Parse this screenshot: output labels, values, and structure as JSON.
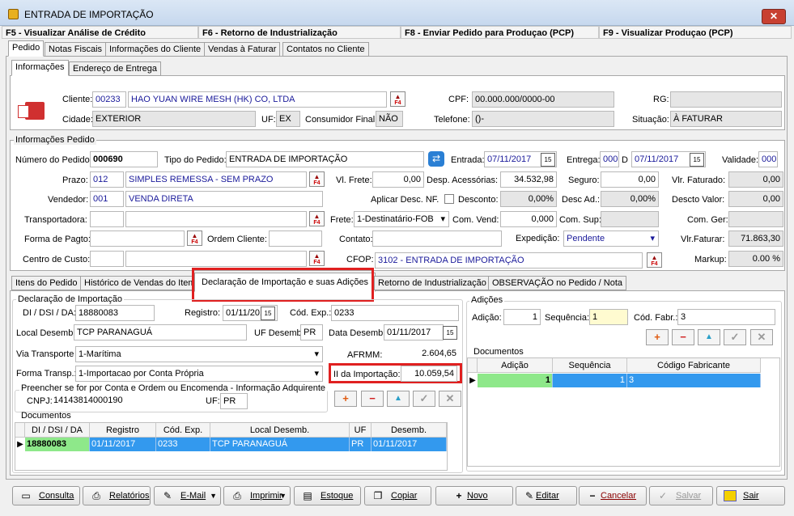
{
  "window": {
    "title": "ENTRADA DE IMPORTAÇÃO",
    "close": "✕"
  },
  "fkeys": [
    "F5 - Visualizar Análise de Crédito",
    "F6 - Retorno de Industrialização",
    "F8 - Enviar Pedido para Produçao (PCP)",
    "F9 - Visualizar Produçao (PCP)"
  ],
  "main_tabs": [
    "Pedido",
    "Notas Fiscais",
    "Informações do Cliente",
    "Vendas à Faturar",
    "Contatos no Cliente"
  ],
  "sub_tabs": [
    "Informações",
    "Endereço de Entrega"
  ],
  "client": {
    "cliente_label": "Cliente:",
    "cliente_code": "00233",
    "cliente_name": "HAO YUAN WIRE MESH (HK) CO, LTDA",
    "cpf_label": "CPF:",
    "cpf": "00.000.000/0000-00",
    "rg_label": "RG:",
    "cidade_label": "Cidade:",
    "cidade": "EXTERIOR",
    "uf_label": "UF:",
    "uf": "EX",
    "consumidor_label": "Consumidor Final:",
    "consumidor": "NÃO",
    "telefone_label": "Telefone:",
    "telefone": "()-",
    "situacao_label": "Situação:",
    "situacao": "À FATURAR"
  },
  "pedido": {
    "group_title": "Informações Pedido",
    "numero_label": "Número do Pedido:",
    "numero": "000690",
    "tipo_label": "Tipo do Pedido:",
    "tipo": "ENTRADA DE IMPORTAÇÃO",
    "entrada_label": "Entrada:",
    "entrada": "07/11/2017",
    "entrega_label": "Entrega:",
    "entrega_dias": "000",
    "entrega_d": "D",
    "entrega_date": "07/11/2017",
    "validade_label": "Validade:",
    "validade": "000",
    "prazo_label": "Prazo:",
    "prazo_code": "012",
    "prazo_name": "SIMPLES REMESSA - SEM PRAZO",
    "frete_label": "Vl. Frete:",
    "frete": "0,00",
    "desp_label": "Desp. Acessórias:",
    "desp": "34.532,98",
    "seguro_label": "Seguro:",
    "seguro": "0,00",
    "vlrfat_label": "Vlr. Faturado:",
    "vlrfat": "0,00",
    "vendedor_label": "Vendedor:",
    "vendedor_code": "001",
    "vendedor_name": "VENDA DIRETA",
    "aplicar_label": "Aplicar Desc. NF.",
    "desconto_label": "Desconto:",
    "desconto": "0,00%",
    "descad_label": "Desc Ad.:",
    "descad": "0,00%",
    "descval_label": "Descto Valor:",
    "descval": "0,00",
    "transp_label": "Transportadora:",
    "fretetype_label": "Frete:",
    "fretetype": "1-Destinatário-FOB",
    "comvend_label": "Com. Vend:",
    "comvend": "0,000",
    "comsup_label": "Com. Sup:",
    "comger_label": "Com. Ger:",
    "formapag_label": "Forma de Pagto:",
    "ordem_label": "Ordem Cliente:",
    "contato_label": "Contato:",
    "expedicao_label": "Expedição:",
    "expedicao": "Pendente",
    "vlrfatur_label": "Vlr.Faturar:",
    "vlrfatur": "71.863,30",
    "custo_label": "Centro de Custo:",
    "cfop_label": "CFOP:",
    "cfop": "3102 - ENTRADA DE IMPORTAÇÃO",
    "markup_label": "Markup:",
    "markup": "0.00 %"
  },
  "detail_tabs": [
    "Itens do Pedido",
    "Histórico de Vendas do Item",
    "Declaração de Importação e suas Adições",
    "Retorno de Industrialização",
    "OBSERVAÇÃO no Pedido / Nota"
  ],
  "di": {
    "group_title": "Declaração de Importação",
    "di_label": "DI / DSI / DA:",
    "di": "18880083",
    "registro_label": "Registro:",
    "registro": "01/11/2017",
    "codexp_label": "Cód. Exp.:",
    "codexp": "0233",
    "local_label": "Local Desemb.",
    "local": "TCP PARANAGUÁ",
    "ufdesemb_label": "UF Desemb.",
    "ufdesemb": "PR",
    "datadesemb_label": "Data Desemb.",
    "datadesemb": "01/11/2017",
    "via_label": "Via Transporte",
    "via": "1-Marítima",
    "afrmm_label": "AFRMM:",
    "afrmm": "2.604,65",
    "forma_label": "Forma Transp.:",
    "forma": "1-Importacao por Conta Própria",
    "ii_label": "II da Importação:",
    "ii": "10.059,54",
    "adquirente_title": "Preencher se for por Conta e Ordem ou Encomenda - Informação Adquirente",
    "cnpj_label": "CNPJ:",
    "cnpj": "14143814000190",
    "uf_label": "UF:",
    "uf": "PR",
    "docs_title": "Documentos",
    "columns": [
      "DI / DSI / DA",
      "Registro",
      "Cód. Exp.",
      "Local Desemb.",
      "UF",
      "Desemb."
    ],
    "row": [
      "18880083",
      "01/11/2017",
      "0233",
      "TCP PARANAGUÁ",
      "PR",
      "01/11/2017"
    ]
  },
  "adicoes": {
    "group_title": "Adições",
    "adicao_label": "Adição:",
    "adicao": "1",
    "sequencia_label": "Sequência:",
    "sequencia": "1",
    "codfabr_label": "Cód. Fabr.:",
    "codfabr": "3",
    "docs_title": "Documentos",
    "columns": [
      "Adição",
      "Sequência",
      "Código Fabricante"
    ],
    "row": [
      "1",
      "1",
      "3"
    ]
  },
  "buttons": [
    "Consulta",
    "Relatórios",
    "E-Mail",
    "Imprimir",
    "Estoque",
    "Copiar",
    "Novo",
    "Editar",
    "Cancelar",
    "Salvar",
    "Sair"
  ]
}
